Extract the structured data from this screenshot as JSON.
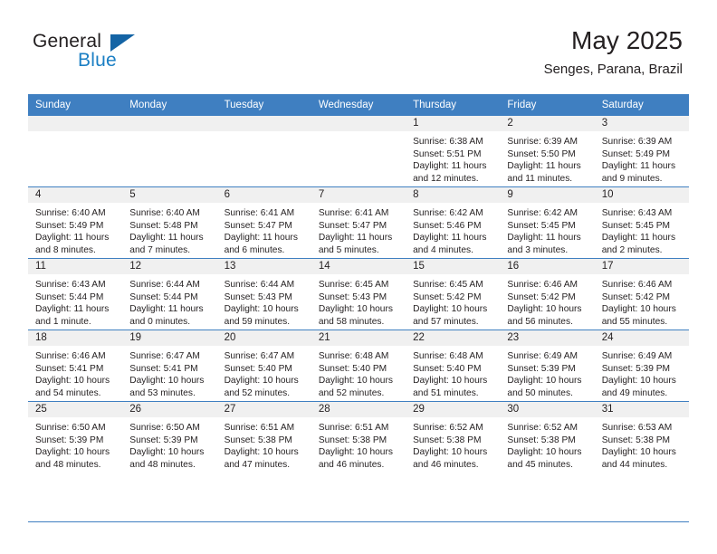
{
  "brand": {
    "name_part1": "General",
    "name_part2": "Blue",
    "triangle_color": "#1464a5",
    "blue_color": "#1b7fc4"
  },
  "header": {
    "month_title": "May 2025",
    "location": "Senges, Parana, Brazil"
  },
  "theme": {
    "header_bg": "#3f7fc1",
    "header_text": "#ffffff",
    "daynum_band_bg": "#f0f0f0",
    "body_text": "#231f20"
  },
  "weekdays": [
    "Sunday",
    "Monday",
    "Tuesday",
    "Wednesday",
    "Thursday",
    "Friday",
    "Saturday"
  ],
  "weeks": [
    [
      {
        "day": "",
        "sunrise": "",
        "sunset": "",
        "daylight_line1": "",
        "daylight_line2": "",
        "empty": true
      },
      {
        "day": "",
        "sunrise": "",
        "sunset": "",
        "daylight_line1": "",
        "daylight_line2": "",
        "empty": true
      },
      {
        "day": "",
        "sunrise": "",
        "sunset": "",
        "daylight_line1": "",
        "daylight_line2": "",
        "empty": true
      },
      {
        "day": "",
        "sunrise": "",
        "sunset": "",
        "daylight_line1": "",
        "daylight_line2": "",
        "empty": true
      },
      {
        "day": "1",
        "sunrise": "Sunrise: 6:38 AM",
        "sunset": "Sunset: 5:51 PM",
        "daylight_line1": "Daylight: 11 hours",
        "daylight_line2": "and 12 minutes."
      },
      {
        "day": "2",
        "sunrise": "Sunrise: 6:39 AM",
        "sunset": "Sunset: 5:50 PM",
        "daylight_line1": "Daylight: 11 hours",
        "daylight_line2": "and 11 minutes."
      },
      {
        "day": "3",
        "sunrise": "Sunrise: 6:39 AM",
        "sunset": "Sunset: 5:49 PM",
        "daylight_line1": "Daylight: 11 hours",
        "daylight_line2": "and 9 minutes."
      }
    ],
    [
      {
        "day": "4",
        "sunrise": "Sunrise: 6:40 AM",
        "sunset": "Sunset: 5:49 PM",
        "daylight_line1": "Daylight: 11 hours",
        "daylight_line2": "and 8 minutes."
      },
      {
        "day": "5",
        "sunrise": "Sunrise: 6:40 AM",
        "sunset": "Sunset: 5:48 PM",
        "daylight_line1": "Daylight: 11 hours",
        "daylight_line2": "and 7 minutes."
      },
      {
        "day": "6",
        "sunrise": "Sunrise: 6:41 AM",
        "sunset": "Sunset: 5:47 PM",
        "daylight_line1": "Daylight: 11 hours",
        "daylight_line2": "and 6 minutes."
      },
      {
        "day": "7",
        "sunrise": "Sunrise: 6:41 AM",
        "sunset": "Sunset: 5:47 PM",
        "daylight_line1": "Daylight: 11 hours",
        "daylight_line2": "and 5 minutes."
      },
      {
        "day": "8",
        "sunrise": "Sunrise: 6:42 AM",
        "sunset": "Sunset: 5:46 PM",
        "daylight_line1": "Daylight: 11 hours",
        "daylight_line2": "and 4 minutes."
      },
      {
        "day": "9",
        "sunrise": "Sunrise: 6:42 AM",
        "sunset": "Sunset: 5:45 PM",
        "daylight_line1": "Daylight: 11 hours",
        "daylight_line2": "and 3 minutes."
      },
      {
        "day": "10",
        "sunrise": "Sunrise: 6:43 AM",
        "sunset": "Sunset: 5:45 PM",
        "daylight_line1": "Daylight: 11 hours",
        "daylight_line2": "and 2 minutes."
      }
    ],
    [
      {
        "day": "11",
        "sunrise": "Sunrise: 6:43 AM",
        "sunset": "Sunset: 5:44 PM",
        "daylight_line1": "Daylight: 11 hours",
        "daylight_line2": "and 1 minute."
      },
      {
        "day": "12",
        "sunrise": "Sunrise: 6:44 AM",
        "sunset": "Sunset: 5:44 PM",
        "daylight_line1": "Daylight: 11 hours",
        "daylight_line2": "and 0 minutes."
      },
      {
        "day": "13",
        "sunrise": "Sunrise: 6:44 AM",
        "sunset": "Sunset: 5:43 PM",
        "daylight_line1": "Daylight: 10 hours",
        "daylight_line2": "and 59 minutes."
      },
      {
        "day": "14",
        "sunrise": "Sunrise: 6:45 AM",
        "sunset": "Sunset: 5:43 PM",
        "daylight_line1": "Daylight: 10 hours",
        "daylight_line2": "and 58 minutes."
      },
      {
        "day": "15",
        "sunrise": "Sunrise: 6:45 AM",
        "sunset": "Sunset: 5:42 PM",
        "daylight_line1": "Daylight: 10 hours",
        "daylight_line2": "and 57 minutes."
      },
      {
        "day": "16",
        "sunrise": "Sunrise: 6:46 AM",
        "sunset": "Sunset: 5:42 PM",
        "daylight_line1": "Daylight: 10 hours",
        "daylight_line2": "and 56 minutes."
      },
      {
        "day": "17",
        "sunrise": "Sunrise: 6:46 AM",
        "sunset": "Sunset: 5:42 PM",
        "daylight_line1": "Daylight: 10 hours",
        "daylight_line2": "and 55 minutes."
      }
    ],
    [
      {
        "day": "18",
        "sunrise": "Sunrise: 6:46 AM",
        "sunset": "Sunset: 5:41 PM",
        "daylight_line1": "Daylight: 10 hours",
        "daylight_line2": "and 54 minutes."
      },
      {
        "day": "19",
        "sunrise": "Sunrise: 6:47 AM",
        "sunset": "Sunset: 5:41 PM",
        "daylight_line1": "Daylight: 10 hours",
        "daylight_line2": "and 53 minutes."
      },
      {
        "day": "20",
        "sunrise": "Sunrise: 6:47 AM",
        "sunset": "Sunset: 5:40 PM",
        "daylight_line1": "Daylight: 10 hours",
        "daylight_line2": "and 52 minutes."
      },
      {
        "day": "21",
        "sunrise": "Sunrise: 6:48 AM",
        "sunset": "Sunset: 5:40 PM",
        "daylight_line1": "Daylight: 10 hours",
        "daylight_line2": "and 52 minutes."
      },
      {
        "day": "22",
        "sunrise": "Sunrise: 6:48 AM",
        "sunset": "Sunset: 5:40 PM",
        "daylight_line1": "Daylight: 10 hours",
        "daylight_line2": "and 51 minutes."
      },
      {
        "day": "23",
        "sunrise": "Sunrise: 6:49 AM",
        "sunset": "Sunset: 5:39 PM",
        "daylight_line1": "Daylight: 10 hours",
        "daylight_line2": "and 50 minutes."
      },
      {
        "day": "24",
        "sunrise": "Sunrise: 6:49 AM",
        "sunset": "Sunset: 5:39 PM",
        "daylight_line1": "Daylight: 10 hours",
        "daylight_line2": "and 49 minutes."
      }
    ],
    [
      {
        "day": "25",
        "sunrise": "Sunrise: 6:50 AM",
        "sunset": "Sunset: 5:39 PM",
        "daylight_line1": "Daylight: 10 hours",
        "daylight_line2": "and 48 minutes."
      },
      {
        "day": "26",
        "sunrise": "Sunrise: 6:50 AM",
        "sunset": "Sunset: 5:39 PM",
        "daylight_line1": "Daylight: 10 hours",
        "daylight_line2": "and 48 minutes."
      },
      {
        "day": "27",
        "sunrise": "Sunrise: 6:51 AM",
        "sunset": "Sunset: 5:38 PM",
        "daylight_line1": "Daylight: 10 hours",
        "daylight_line2": "and 47 minutes."
      },
      {
        "day": "28",
        "sunrise": "Sunrise: 6:51 AM",
        "sunset": "Sunset: 5:38 PM",
        "daylight_line1": "Daylight: 10 hours",
        "daylight_line2": "and 46 minutes."
      },
      {
        "day": "29",
        "sunrise": "Sunrise: 6:52 AM",
        "sunset": "Sunset: 5:38 PM",
        "daylight_line1": "Daylight: 10 hours",
        "daylight_line2": "and 46 minutes."
      },
      {
        "day": "30",
        "sunrise": "Sunrise: 6:52 AM",
        "sunset": "Sunset: 5:38 PM",
        "daylight_line1": "Daylight: 10 hours",
        "daylight_line2": "and 45 minutes."
      },
      {
        "day": "31",
        "sunrise": "Sunrise: 6:53 AM",
        "sunset": "Sunset: 5:38 PM",
        "daylight_line1": "Daylight: 10 hours",
        "daylight_line2": "and 44 minutes."
      }
    ]
  ]
}
